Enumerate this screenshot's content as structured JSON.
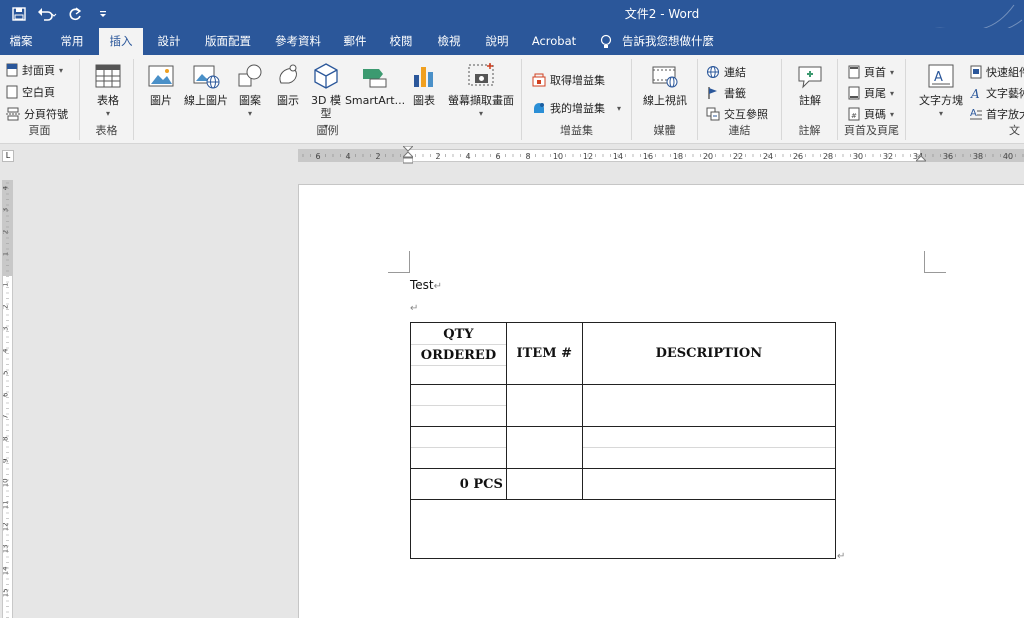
{
  "window": {
    "title": "文件2  -  Word"
  },
  "quick_access": [
    "save-icon",
    "undo-icon",
    "redo-icon",
    "customize-icon"
  ],
  "tabs": [
    {
      "label": "檔案"
    },
    {
      "label": "常用"
    },
    {
      "label": "插入"
    },
    {
      "label": "設計"
    },
    {
      "label": "版面配置"
    },
    {
      "label": "參考資料"
    },
    {
      "label": "郵件"
    },
    {
      "label": "校閱"
    },
    {
      "label": "檢視"
    },
    {
      "label": "說明"
    },
    {
      "label": "Acrobat"
    },
    {
      "label": "告訴我您想做什麼"
    }
  ],
  "ribbon": {
    "pages": {
      "label": "頁面",
      "cover": "封面頁",
      "blank": "空白頁",
      "break": "分頁符號"
    },
    "tables": {
      "label": "表格",
      "table": "表格"
    },
    "illustrations": {
      "label": "圖例",
      "picture": "圖片",
      "online_picture": "線上圖片",
      "shapes": "圖案",
      "icons": "圖示",
      "model_3d_l1": "3D 模",
      "model_3d_l2": "型",
      "smartart": "SmartArt...",
      "chart": "圖表",
      "screenshot": "螢幕擷取畫面"
    },
    "addins": {
      "label": "增益集",
      "get": "取得增益集",
      "my": "我的增益集"
    },
    "media": {
      "label": "媒體",
      "online_video": "線上視訊"
    },
    "links": {
      "label": "連結",
      "link": "連結",
      "bookmark": "書籤",
      "xref": "交互參照"
    },
    "comments": {
      "label": "註解",
      "comment": "註解"
    },
    "header_footer": {
      "label": "頁首及頁尾",
      "header": "頁首",
      "footer": "頁尾",
      "page_number": "頁碼"
    },
    "text": {
      "label": "文",
      "textbox": "文字方塊",
      "quick_parts": "快速組件",
      "wordart": "文字藝術",
      "dropcap": "首字放大"
    }
  },
  "ruler": {
    "h_labels": [
      "6",
      "4",
      "2",
      "2",
      "4",
      "6",
      "8",
      "10",
      "12",
      "14",
      "16",
      "18",
      "20",
      "22",
      "24",
      "26",
      "28",
      "30",
      "32",
      "34",
      "36",
      "38",
      "40"
    ],
    "v_labels": [
      "4",
      "3",
      "2",
      "1",
      "1",
      "2",
      "3",
      "4",
      "5",
      "6",
      "7",
      "8",
      "9",
      "10",
      "11",
      "12",
      "13",
      "14",
      "15"
    ]
  },
  "document": {
    "line1": "Test",
    "para_mark": "↵",
    "table": {
      "header": {
        "qty_line1": "QTY",
        "qty_line2": "ORDERED",
        "item": "ITEM #",
        "description": "DESCRIPTION"
      },
      "total_qty": "0 PCS"
    }
  }
}
